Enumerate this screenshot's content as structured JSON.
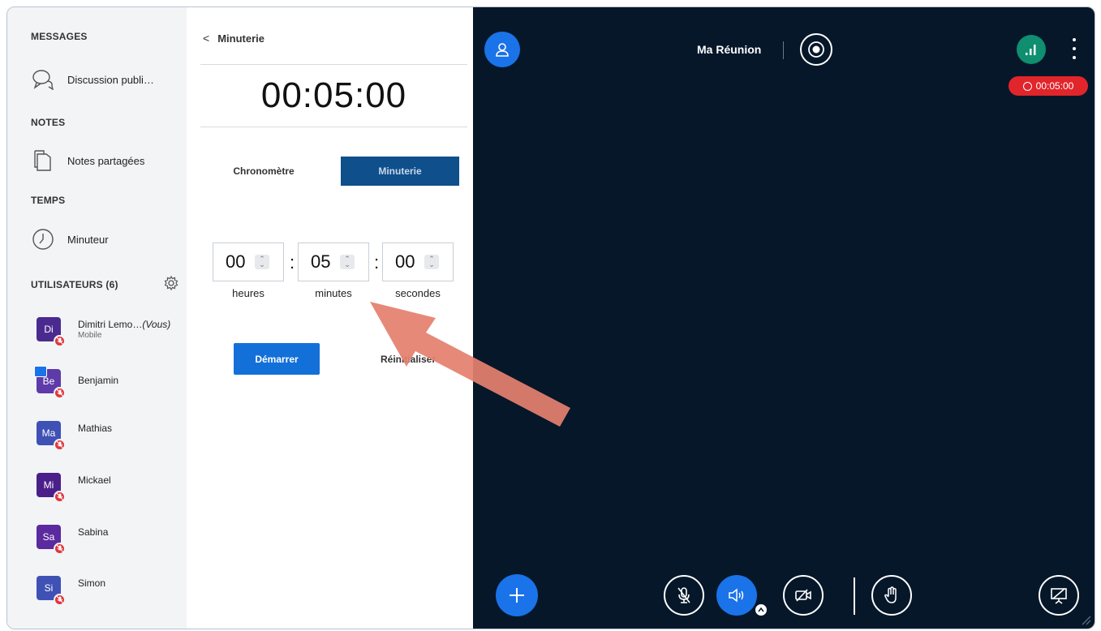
{
  "sidebar": {
    "messages_title": "MESSAGES",
    "chat_label": "Discussion publi…",
    "notes_title": "NOTES",
    "notes_label": "Notes partagées",
    "time_title": "TEMPS",
    "timer_label": "Minuteur",
    "users_title": "UTILISATEURS (6)",
    "users": [
      {
        "initials": "Di",
        "name": "Dimitri Lemo…",
        "you": "(Vous)",
        "sub": "Mobile",
        "color": "#4b2a8f"
      },
      {
        "initials": "Be",
        "name": "Benjamin",
        "color": "#5e3ba8",
        "presenter": true
      },
      {
        "initials": "Ma",
        "name": "Mathias",
        "color": "#3f51b5"
      },
      {
        "initials": "Mi",
        "name": "Mickael",
        "color": "#4b1f8a"
      },
      {
        "initials": "Sa",
        "name": "Sabina",
        "color": "#5a2a9e"
      },
      {
        "initials": "Si",
        "name": "Simon",
        "color": "#3f51b5"
      }
    ]
  },
  "panel": {
    "back_label": "Minuterie",
    "display_time": "00:05:00",
    "tab_stopwatch": "Chronomètre",
    "tab_timer": "Minuterie",
    "hours": "00",
    "minutes": "05",
    "seconds": "00",
    "hours_label": "heures",
    "minutes_label": "minutes",
    "seconds_label": "secondes",
    "start_label": "Démarrer",
    "reset_label": "Réinitialiser"
  },
  "meeting": {
    "title": "Ma Réunion",
    "timer_badge": "00:05:00",
    "colors": {
      "background": "#06172a",
      "accent": "#1a73e8",
      "connection": "#0f8e70",
      "timer": "#e0252b"
    }
  },
  "icons": [
    "chat-icon",
    "notes-icon",
    "clock-icon",
    "gear-icon",
    "user-icon",
    "record-icon",
    "connection-icon",
    "more-icon",
    "plus-icon",
    "mic-muted-icon",
    "speaker-icon",
    "camera-off-icon",
    "hand-icon",
    "presentation-icon"
  ]
}
